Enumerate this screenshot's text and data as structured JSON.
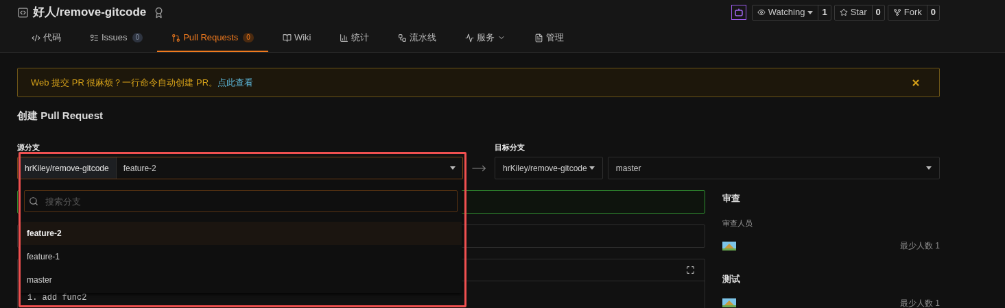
{
  "repo": {
    "title": "好人/remove-gitcode"
  },
  "actions": [
    {
      "label": "Watching",
      "count": "1",
      "caret": true
    },
    {
      "label": "Star",
      "count": "0",
      "caret": false
    },
    {
      "label": "Fork",
      "count": "0",
      "caret": false
    }
  ],
  "tabs": [
    {
      "label": "代码",
      "selected": false
    },
    {
      "label": "Issues",
      "count": "0",
      "selected": false
    },
    {
      "label": "Pull Requests",
      "count": "0",
      "selected": true
    },
    {
      "label": "Wiki",
      "selected": false
    },
    {
      "label": "统计",
      "selected": false
    },
    {
      "label": "流水线",
      "selected": false
    },
    {
      "label": "服务",
      "caret": true,
      "selected": false
    },
    {
      "label": "管理",
      "selected": false
    }
  ],
  "banner": {
    "text": "Web 提交 PR 很麻烦？一行命令自动创建 PR。",
    "link": "点此查看"
  },
  "page_title": "创建 Pull Request",
  "source": {
    "label": "源分支",
    "repo": "hrKiley/remove-gitcode",
    "branch": "feature-2"
  },
  "target": {
    "label": "目标分支",
    "repo": "hrKiley/remove-gitcode",
    "branch": "master"
  },
  "dropdown": {
    "placeholder": "搜索分支",
    "branches": [
      {
        "name": "feature-2",
        "selected": true
      },
      {
        "name": "feature-1",
        "selected": false
      },
      {
        "name": "master",
        "selected": false
      }
    ]
  },
  "editor": {
    "first_line": "1. add func2"
  },
  "sidebar": [
    {
      "title": "审查",
      "subtitle": "审查人员",
      "min": "最少人数 1"
    },
    {
      "title": "测试",
      "min": "最少人数 1"
    }
  ]
}
